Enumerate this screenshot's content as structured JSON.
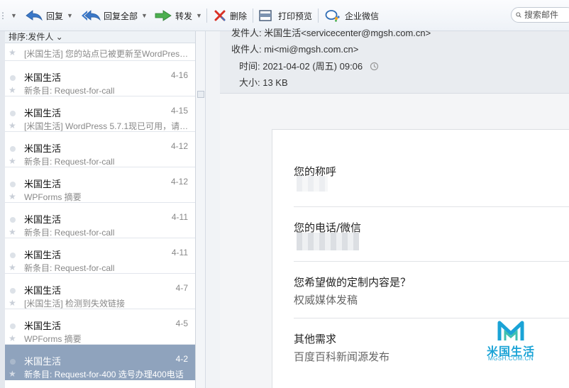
{
  "toolbar": {
    "reply": "回复",
    "reply_all": "回复全部",
    "forward": "转发",
    "delete": "删除",
    "print_preview": "打印预览",
    "wecom": "企业微信",
    "search_placeholder": "搜索邮件"
  },
  "list": {
    "sort_label": "排序:发件人 ⌄",
    "partial_subject": "[米国生活] 您的站点已被更新至WordPress ...",
    "items": [
      {
        "sender": "米国生活",
        "date": "4-16",
        "subject": "新条目: Request-for-call"
      },
      {
        "sender": "米国生活",
        "date": "4-15",
        "subject": "[米国生活] WordPress 5.7.1现已可用，请更..."
      },
      {
        "sender": "米国生活",
        "date": "4-12",
        "subject": "新条目: Request-for-call"
      },
      {
        "sender": "米国生活",
        "date": "4-12",
        "subject": "WPForms 摘要"
      },
      {
        "sender": "米国生活",
        "date": "4-11",
        "subject": "新条目: Request-for-call"
      },
      {
        "sender": "米国生活",
        "date": "4-11",
        "subject": "新条目: Request-for-call"
      },
      {
        "sender": "米国生活",
        "date": "4-7",
        "subject": "[米国生活] 检测到失效链接"
      },
      {
        "sender": "米国生活",
        "date": "4-5",
        "subject": "WPForms 摘要"
      },
      {
        "sender": "米国生活",
        "date": "4-2",
        "subject": "新条目: Request-for-400 选号办理400电话"
      }
    ],
    "selected_index": 8
  },
  "message": {
    "from_line": "发件人: 米国生活<servicecenter@mgsh.com.cn>",
    "to_line": "收件人: mi<mi@mgsh.com.cn>",
    "time_line": "时间: 2021-04-02 (周五) 09:06",
    "size_line": "大小: 13 KB"
  },
  "form": {
    "name_label": "您的称呼",
    "phone_label": "您的电话/微信",
    "custom_label": "您希望做的定制内容是？",
    "custom_value": "权威媒体发稿",
    "other_label": "其他需求",
    "other_value": "百度百科新闻源发布"
  },
  "watermark": {
    "logo_letter": "M",
    "brand": "米国生活",
    "domain": "MGSH.COM.CN"
  },
  "colors": {
    "selected_row": "#8fa3bd",
    "accent_blue": "#2f6db5",
    "delete_red": "#d93025",
    "forward_green": "#43a047",
    "watermark": "#1aa3d6"
  }
}
